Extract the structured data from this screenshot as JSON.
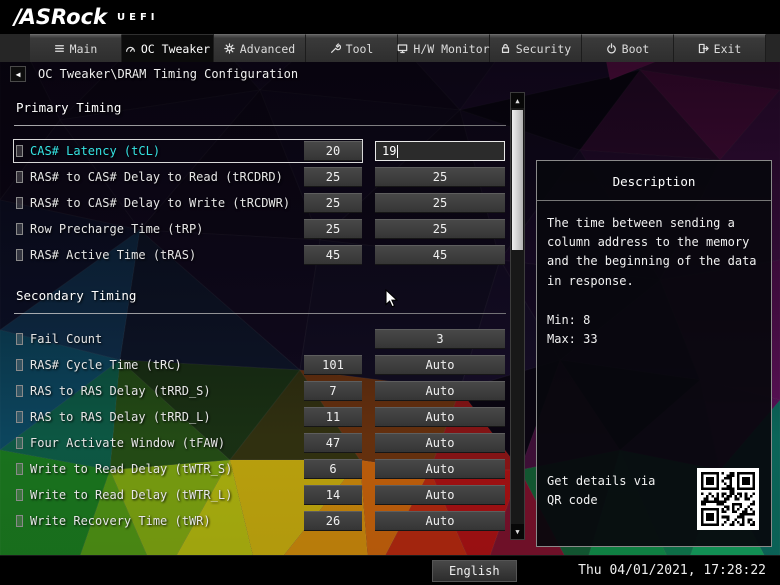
{
  "header": {
    "brand": "ASRock",
    "product": "UEFI"
  },
  "tabs": [
    {
      "label": "Main",
      "icon": "menu-icon",
      "active": false
    },
    {
      "label": "OC Tweaker",
      "icon": "gauge-icon",
      "active": true
    },
    {
      "label": "Advanced",
      "icon": "gear-icon",
      "active": false
    },
    {
      "label": "Tool",
      "icon": "wrench-icon",
      "active": false
    },
    {
      "label": "H/W Monitor",
      "icon": "monitor-icon",
      "active": false
    },
    {
      "label": "Security",
      "icon": "lock-icon",
      "active": false
    },
    {
      "label": "Boot",
      "icon": "power-icon",
      "active": false
    },
    {
      "label": "Exit",
      "icon": "exit-icon",
      "active": false
    }
  ],
  "breadcrumb": {
    "back_glyph": "◀",
    "path": "OC Tweaker\\DRAM Timing Configuration"
  },
  "sections": [
    {
      "title": "Primary Timing",
      "rows": [
        {
          "label": "CAS# Latency (tCL)",
          "value": "20",
          "value2": "19",
          "selected": true,
          "editing": true
        },
        {
          "label": "RAS# to CAS# Delay to Read  (tRCDRD)",
          "value": "25",
          "value2": "25",
          "selected": false,
          "editing": false
        },
        {
          "label": "RAS# to CAS# Delay to Write (tRCDWR)",
          "value": "25",
          "value2": "25",
          "selected": false,
          "editing": false
        },
        {
          "label": "Row Precharge Time (tRP)",
          "value": "25",
          "value2": "25",
          "selected": false,
          "editing": false
        },
        {
          "label": "RAS# Active Time (tRAS)",
          "value": "45",
          "value2": "45",
          "selected": false,
          "editing": false
        }
      ]
    },
    {
      "title": "Secondary Timing",
      "rows": [
        {
          "label": "Fail Count",
          "value": "",
          "value2": "3",
          "selected": false,
          "editing": false
        },
        {
          "label": "RAS# Cycle Time (tRC)",
          "value": "101",
          "value2": "Auto",
          "selected": false,
          "editing": false
        },
        {
          "label": "RAS to RAS Delay (tRRD_S)",
          "value": "7",
          "value2": "Auto",
          "selected": false,
          "editing": false
        },
        {
          "label": "RAS to RAS Delay (tRRD_L)",
          "value": "11",
          "value2": "Auto",
          "selected": false,
          "editing": false
        },
        {
          "label": "Four Activate Window (tFAW)",
          "value": "47",
          "value2": "Auto",
          "selected": false,
          "editing": false
        },
        {
          "label": "Write to Read Delay (tWTR_S)",
          "value": "6",
          "value2": "Auto",
          "selected": false,
          "editing": false
        },
        {
          "label": "Write to Read Delay (tWTR_L)",
          "value": "14",
          "value2": "Auto",
          "selected": false,
          "editing": false
        },
        {
          "label": "Write Recovery Time (tWR)",
          "value": "26",
          "value2": "Auto",
          "selected": false,
          "editing": false
        }
      ]
    }
  ],
  "scrollbar": {
    "up_glyph": "▲",
    "down_glyph": "▼"
  },
  "description_panel": {
    "title": "Description",
    "body": "The time between sending a column address to the memory and the beginning of the data in response.",
    "min_label": "Min: 8",
    "max_label": "Max: 33",
    "qr_hint": "Get details via QR code"
  },
  "status_bar": {
    "language_label": "English",
    "datetime": "Thu 04/01/2021, 17:28:22"
  },
  "colors": {
    "accent_cyan": "#35e2e2",
    "value_box_bg": "#3b3b3b",
    "tab_active_bg": "#0b0b0b"
  }
}
